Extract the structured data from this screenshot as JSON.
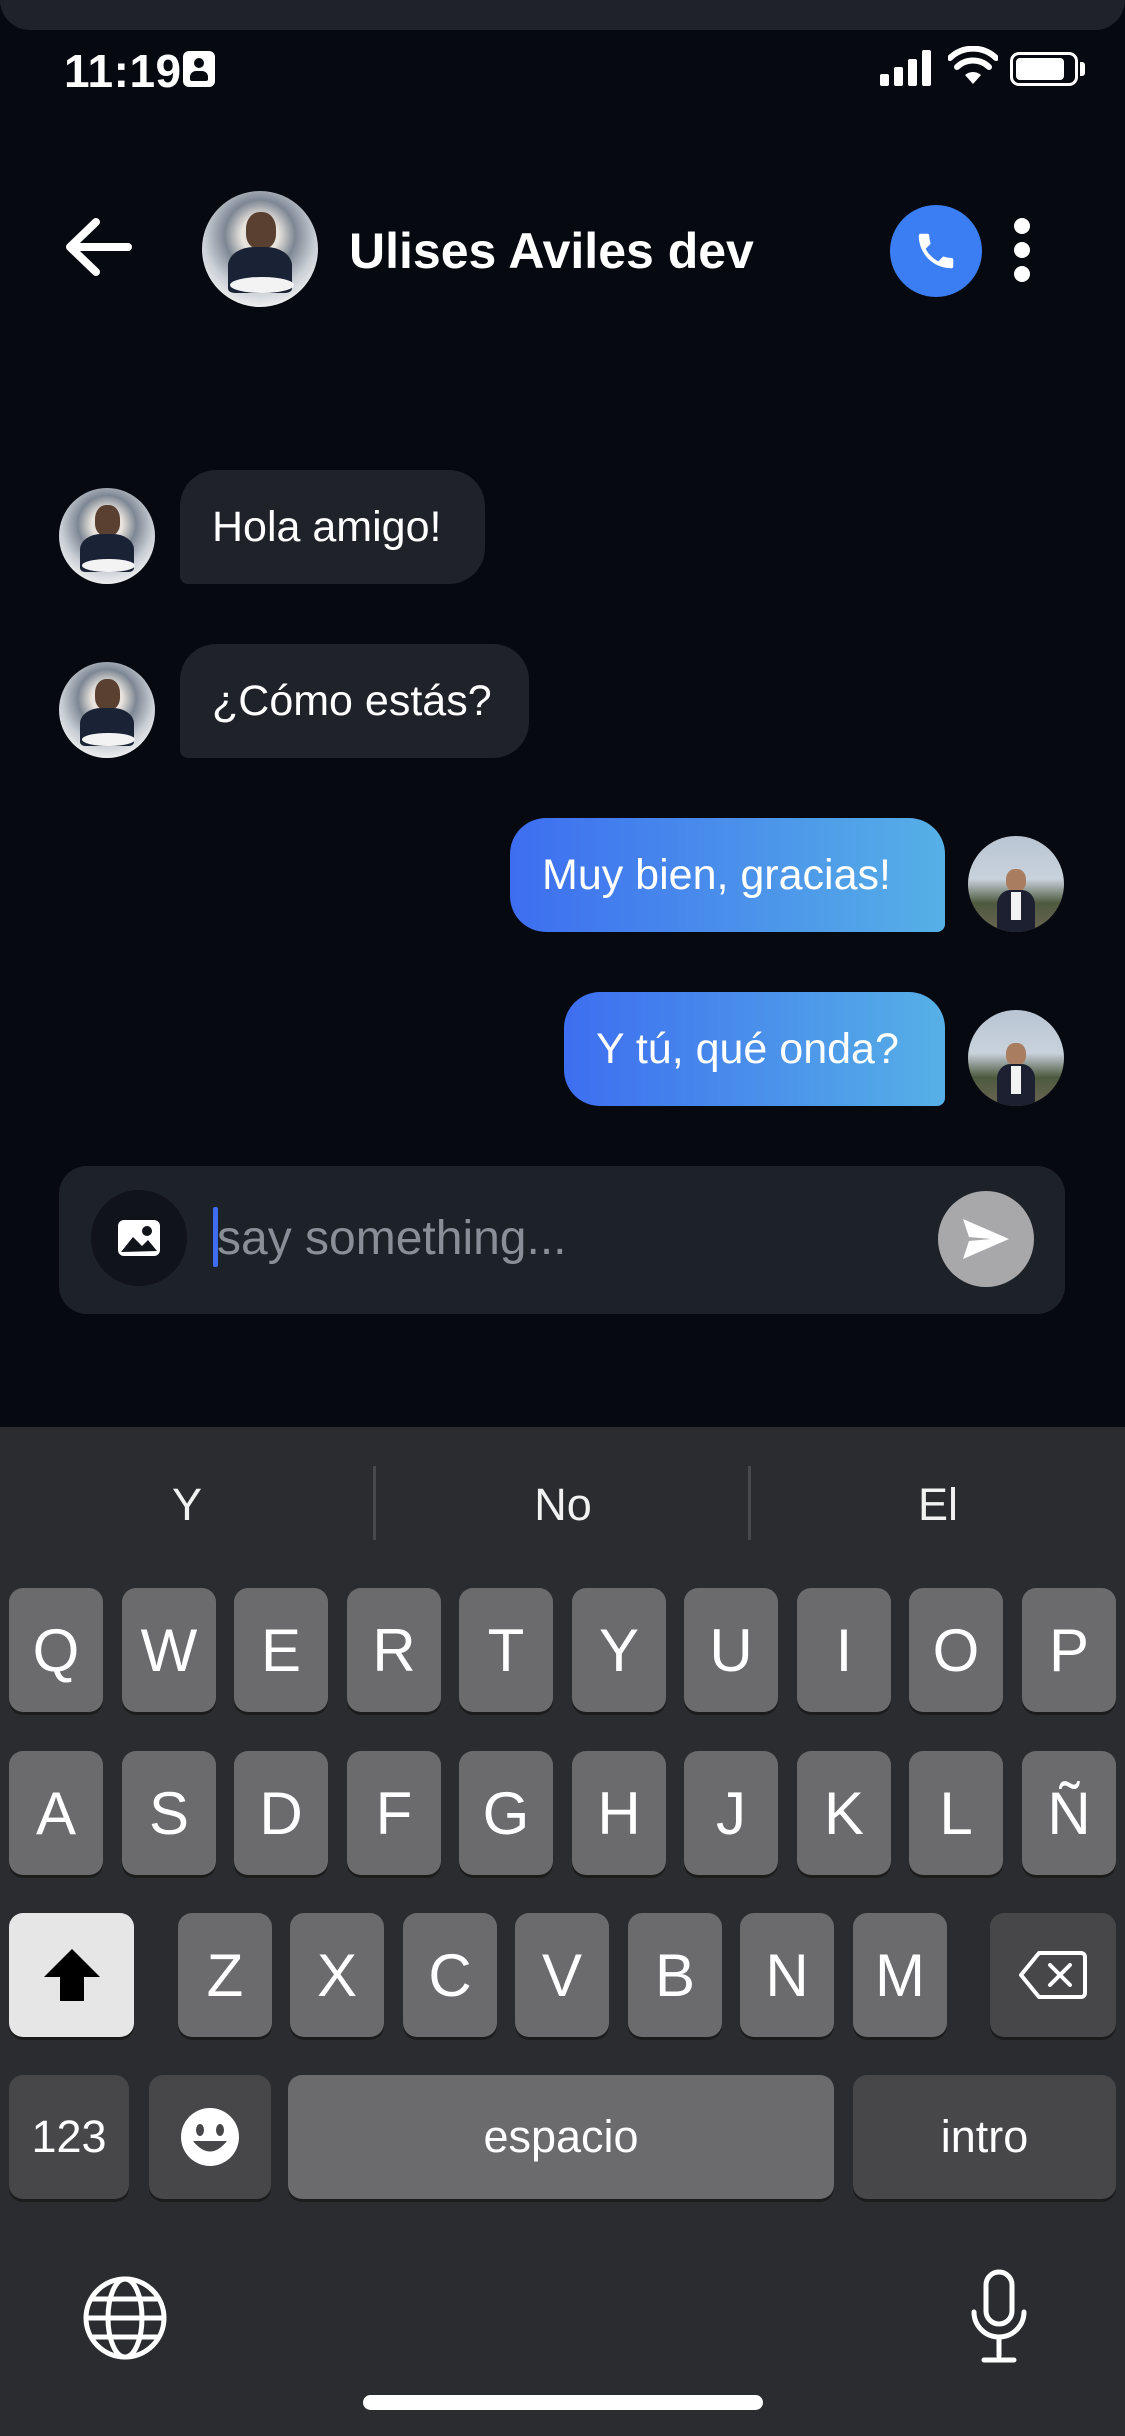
{
  "status_bar": {
    "time": "11:19"
  },
  "header": {
    "name": "Ulises Aviles dev"
  },
  "messages": [
    {
      "text": "Hola amigo!",
      "sender": "other"
    },
    {
      "text": "¿Cómo estás?",
      "sender": "other"
    },
    {
      "text": "Muy bien, gracias!",
      "sender": "me"
    },
    {
      "text": "Y tú, qué onda?",
      "sender": "me"
    }
  ],
  "composer": {
    "placeholder": "say something...",
    "value": ""
  },
  "keyboard": {
    "suggestions": [
      "Y",
      "No",
      "El"
    ],
    "row1": [
      "Q",
      "W",
      "E",
      "R",
      "T",
      "Y",
      "U",
      "I",
      "O",
      "P"
    ],
    "row2": [
      "A",
      "S",
      "D",
      "F",
      "G",
      "H",
      "J",
      "K",
      "L",
      "Ñ"
    ],
    "row3": [
      "Z",
      "X",
      "C",
      "V",
      "B",
      "N",
      "M"
    ],
    "numbers_label": "123",
    "space_label": "espacio",
    "return_label": "intro"
  },
  "colors": {
    "background": "#06090f",
    "accent": "#3b7df2",
    "outgoing_gradient_start": "#3d6ef0",
    "outgoing_gradient_end": "#56b0e6",
    "incoming_bubble": "#1f2329"
  },
  "icons": {
    "back": "arrow-left-icon",
    "call": "phone-icon",
    "more": "more-vertical-icon",
    "image": "image-icon",
    "send": "send-icon",
    "shift": "shift-icon",
    "delete": "backspace-icon",
    "emoji": "emoji-icon",
    "globe": "globe-icon",
    "mic": "microphone-icon"
  }
}
